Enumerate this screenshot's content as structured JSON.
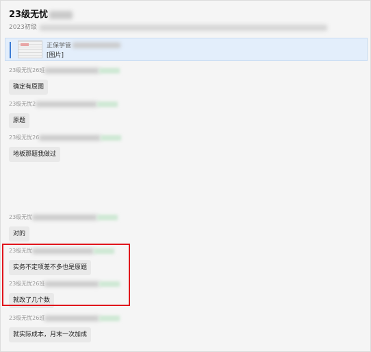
{
  "header": {
    "title": "23级无忧",
    "subtitle": "2023初级"
  },
  "quote": {
    "sender": "正保学管",
    "text": "[图片]"
  },
  "messages": [
    {
      "sender": "23级无忧26班",
      "text": "确定有原图"
    },
    {
      "sender": "23级无忧2",
      "text": "原题"
    },
    {
      "sender": "23级无忧26",
      "text": "地板那题我做过"
    },
    {
      "sender": "23级无忧",
      "text": "对的"
    },
    {
      "sender": "23级无忧",
      "text": "实务不定项差不多也是原题"
    },
    {
      "sender": "23级无忧26班",
      "text": "就改了几个数"
    },
    {
      "sender": "23级无忧26班",
      "text": "就实际成本，月末一次加成"
    }
  ],
  "colors": {
    "highlight_box": "#e0141b",
    "quote_accent": "#3a7bd5",
    "quote_background": "#e3eefb"
  }
}
